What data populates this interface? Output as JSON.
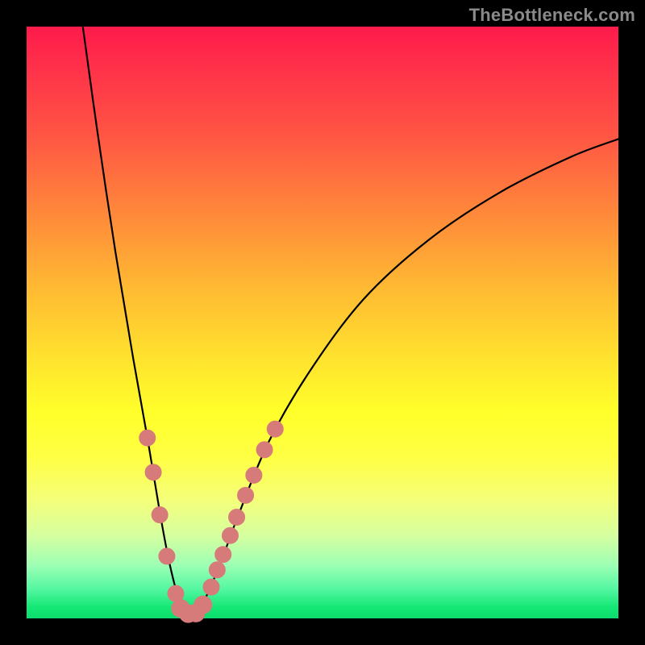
{
  "watermark": "TheBottleneck.com",
  "colors": {
    "curve": "#000000",
    "dot_fill": "#d77a7a",
    "dot_stroke": "#d77a7a"
  },
  "chart_data": {
    "type": "line",
    "title": "",
    "xlabel": "",
    "ylabel": "",
    "xlim": [
      0,
      100
    ],
    "ylim": [
      0,
      100
    ],
    "note": "Bottleneck-style V curve with rainbow gradient background. Minimum of the curve sits near x≈27, y≈0. Left branch steep, right branch shallow. Pink dots cluster on both branches near the bottom.",
    "curve_points": [
      {
        "x": 9.5,
        "y": 100
      },
      {
        "x": 12,
        "y": 82
      },
      {
        "x": 15,
        "y": 62
      },
      {
        "x": 18,
        "y": 44
      },
      {
        "x": 20.5,
        "y": 30
      },
      {
        "x": 22.5,
        "y": 18
      },
      {
        "x": 24,
        "y": 10
      },
      {
        "x": 25.5,
        "y": 4
      },
      {
        "x": 27,
        "y": 0.5
      },
      {
        "x": 28.5,
        "y": 0.5
      },
      {
        "x": 30.5,
        "y": 4
      },
      {
        "x": 33,
        "y": 10
      },
      {
        "x": 36,
        "y": 18
      },
      {
        "x": 41,
        "y": 30
      },
      {
        "x": 48,
        "y": 42
      },
      {
        "x": 57,
        "y": 54
      },
      {
        "x": 68,
        "y": 64
      },
      {
        "x": 80,
        "y": 72
      },
      {
        "x": 92,
        "y": 78
      },
      {
        "x": 100,
        "y": 81
      }
    ],
    "dots": [
      {
        "x": 20.4,
        "y": 30.5,
        "r": 10
      },
      {
        "x": 21.4,
        "y": 24.7,
        "r": 10
      },
      {
        "x": 22.5,
        "y": 17.5,
        "r": 10
      },
      {
        "x": 23.7,
        "y": 10.5,
        "r": 10
      },
      {
        "x": 25.2,
        "y": 4.2,
        "r": 10
      },
      {
        "x": 26.0,
        "y": 1.7,
        "r": 11
      },
      {
        "x": 27.3,
        "y": 0.8,
        "r": 11
      },
      {
        "x": 28.6,
        "y": 0.9,
        "r": 11
      },
      {
        "x": 29.8,
        "y": 2.3,
        "r": 11
      },
      {
        "x": 31.2,
        "y": 5.3,
        "r": 10
      },
      {
        "x": 32.2,
        "y": 8.2,
        "r": 10
      },
      {
        "x": 33.2,
        "y": 10.8,
        "r": 10
      },
      {
        "x": 34.4,
        "y": 14.0,
        "r": 10
      },
      {
        "x": 35.5,
        "y": 17.1,
        "r": 10
      },
      {
        "x": 37.0,
        "y": 20.8,
        "r": 10
      },
      {
        "x": 38.4,
        "y": 24.2,
        "r": 10
      },
      {
        "x": 40.2,
        "y": 28.5,
        "r": 10
      },
      {
        "x": 42.0,
        "y": 32.0,
        "r": 10
      }
    ]
  }
}
